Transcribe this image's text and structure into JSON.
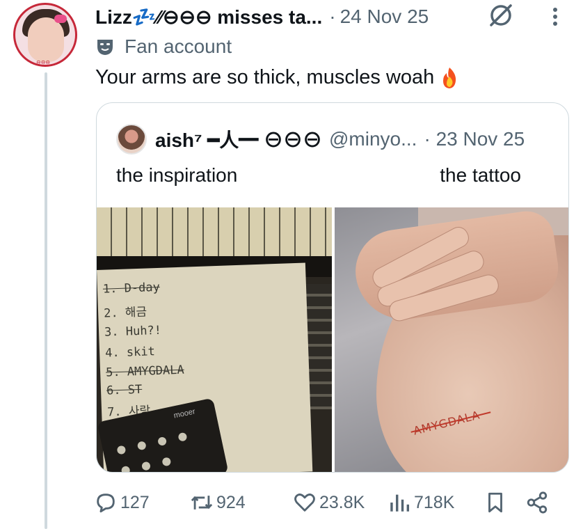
{
  "tweet": {
    "display_name": "Lizz💤⁄⁄⊖⊖⊖ misses ta...",
    "separator": "·",
    "date": "24 Nov 25",
    "label": "Fan account",
    "text": "Your arms are so thick, muscles woah",
    "avatar_tag": "⊖⊖⊖"
  },
  "quote": {
    "display_name": "aish⁷ ━人━ ⊖⊖⊖",
    "handle": "@minyo...",
    "separator": "·",
    "date": "23 Nov 25",
    "left_caption": "the inspiration",
    "right_caption": "the tattoo",
    "image_left": {
      "lines": [
        "1. D-day",
        "2. 해금",
        "3. Huh?!",
        "4. skit",
        "5. AMYGDALA",
        "6. ST",
        "7. 사랑"
      ],
      "device_label": "mooer"
    },
    "image_right": {
      "tattoo_text": "AMYGDALA"
    }
  },
  "actions": {
    "replies": "127",
    "reposts": "924",
    "likes": "23.8K",
    "views": "718K"
  },
  "icons": {
    "grok": "grok-icon",
    "more": "more-vertical-icon",
    "fan_account": "mask-icon",
    "fire": "fire-emoji-icon",
    "reply": "reply-icon",
    "repost": "repost-icon",
    "like": "heart-icon",
    "views": "views-chart-icon",
    "bookmark": "bookmark-icon",
    "share": "share-icon"
  },
  "colors": {
    "text": "#0f1419",
    "muted": "#536471",
    "border": "#cfd9de",
    "avatar_ring": "#c62839"
  }
}
